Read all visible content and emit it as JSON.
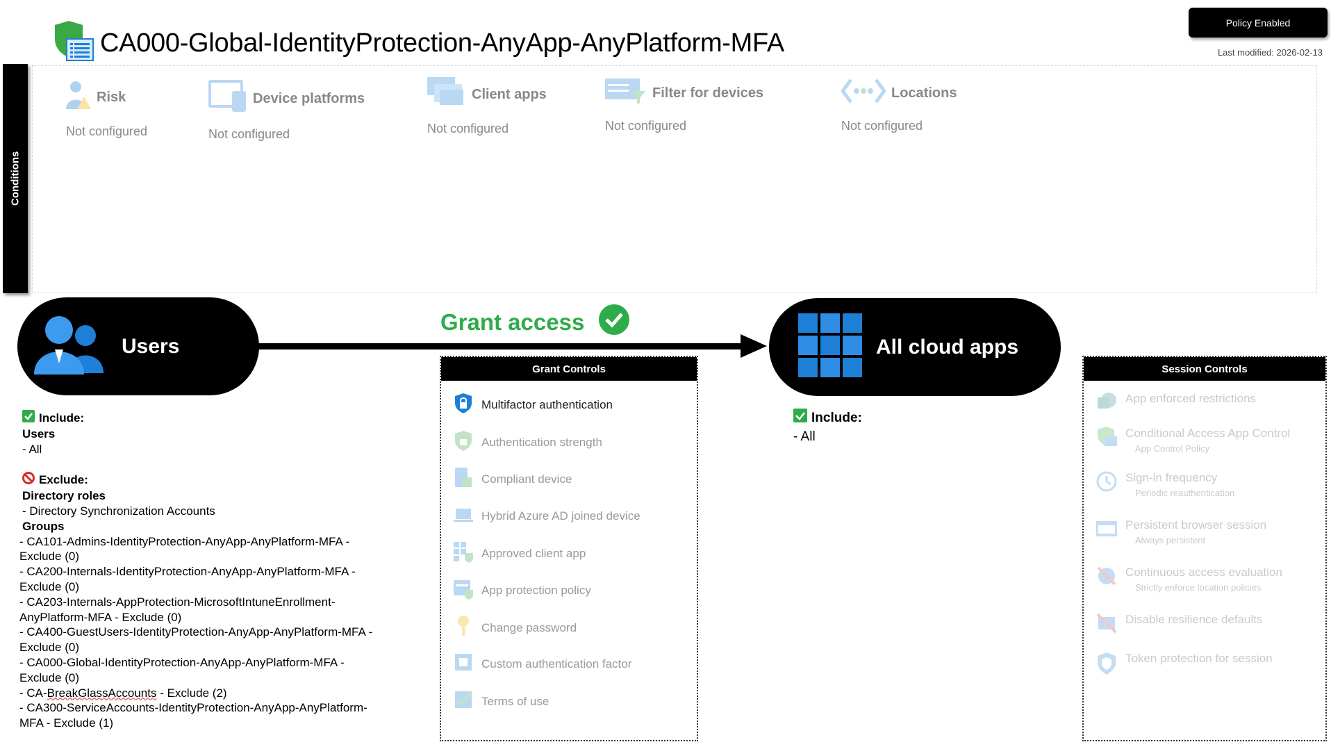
{
  "header": {
    "title": "CA000-Global-IdentityProtection-AnyApp-AnyPlatform-MFA",
    "status_badge": "Policy Enabled",
    "last_modified": "Last modified: 2026-02-13"
  },
  "conditions": {
    "label": "Conditions",
    "items": [
      {
        "name": "Risk",
        "value": "Not configured"
      },
      {
        "name": "Device platforms",
        "value": "Not configured"
      },
      {
        "name": "Client apps",
        "value": "Not configured"
      },
      {
        "name": "Filter for devices",
        "value": "Not configured"
      },
      {
        "name": "Locations",
        "value": "Not configured"
      }
    ]
  },
  "flow": {
    "users_label": "Users",
    "grant_label": "Grant access",
    "apps_label": "All cloud apps"
  },
  "users": {
    "include_label": "Include:",
    "include_heading": "Users",
    "include_value": "- All",
    "exclude_label": "Exclude:",
    "roles_heading": "Directory roles",
    "roles": [
      "- Directory Synchronization Accounts"
    ],
    "groups_heading": "Groups",
    "groups": [
      {
        "lines": [
          "- CA101-Admins-IdentityProtection-AnyApp-AnyPlatform-MFA -",
          "Exclude (0)"
        ]
      },
      {
        "lines": [
          "- CA200-Internals-IdentityProtection-AnyApp-AnyPlatform-MFA -",
          "Exclude (0)"
        ]
      },
      {
        "lines": [
          "- CA203-Internals-AppProtection-MicrosoftIntuneEnrollment-",
          "AnyPlatform-MFA - Exclude (0)"
        ]
      },
      {
        "lines": [
          "- CA400-GuestUsers-IdentityProtection-AnyApp-AnyPlatform-MFA -",
          "Exclude (0)"
        ]
      },
      {
        "lines": [
          "- CA000-Global-IdentityProtection-AnyApp-AnyPlatform-MFA -",
          "Exclude (0)"
        ]
      },
      {
        "prefix": "- CA-",
        "underlined": "BreakGlassAccounts",
        "suffix": " - Exclude (2)"
      },
      {
        "lines": [
          "- CA300-ServiceAccounts-IdentityProtection-AnyApp-AnyPlatform-",
          "MFA - Exclude (1)"
        ]
      }
    ]
  },
  "grant_controls": {
    "title": "Grant Controls",
    "items": [
      {
        "label": "Multifactor authentication",
        "active": true
      },
      {
        "label": "Authentication strength",
        "active": false
      },
      {
        "label": "Compliant device",
        "active": false
      },
      {
        "label": "Hybrid Azure AD joined device",
        "active": false
      },
      {
        "label": "Approved client app",
        "active": false
      },
      {
        "label": "App protection policy",
        "active": false
      },
      {
        "label": "Change password",
        "active": false
      },
      {
        "label": "Custom authentication factor",
        "active": false
      },
      {
        "label": "Terms of use",
        "active": false
      }
    ]
  },
  "apps": {
    "include_label": "Include:",
    "include_value": "- All"
  },
  "session_controls": {
    "title": "Session Controls",
    "items": [
      {
        "label": "App enforced restrictions",
        "sub": ""
      },
      {
        "label": "Conditional Access App Control",
        "sub": "App Control Policy"
      },
      {
        "label": "Sign-in frequency",
        "sub": "Periodic reauthentication"
      },
      {
        "label": "Persistent browser session",
        "sub": "Always persistent"
      },
      {
        "label": "Continuous access evaluation",
        "sub": "Strictly enforce location policies"
      },
      {
        "label": "Disable resilience defaults",
        "sub": ""
      },
      {
        "label": "Token protection for session",
        "sub": ""
      }
    ]
  },
  "colors": {
    "grant_green": "#2eac4a",
    "azure_blue": "#1e7fd6",
    "exclude_red": "#d32f2f"
  }
}
